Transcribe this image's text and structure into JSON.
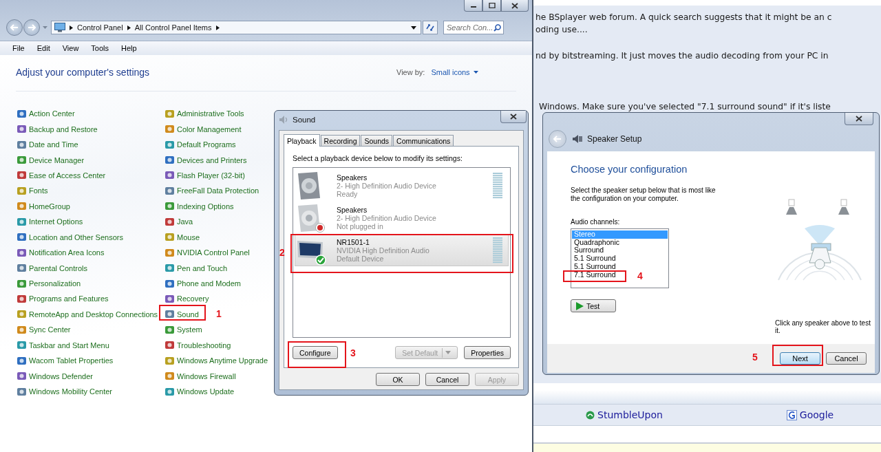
{
  "control_panel": {
    "address": [
      "Control Panel",
      "All Control Panel Items"
    ],
    "search": {
      "placeholder": "Search Con..."
    },
    "menu": [
      "File",
      "Edit",
      "View",
      "Tools",
      "Help"
    ],
    "heading": "Adjust your computer's settings",
    "view_by": {
      "label": "View by:",
      "value": "Small icons"
    },
    "columns": [
      [
        "Action Center",
        "Backup and Restore",
        "Date and Time",
        "Device Manager",
        "Ease of Access Center",
        "Fonts",
        "HomeGroup",
        "Internet Options",
        "Location and Other Sensors",
        "Notification Area Icons",
        "Parental Controls",
        "Personalization",
        "Programs and Features",
        "RemoteApp and Desktop Connections",
        "Sync Center",
        "Taskbar and Start Menu",
        "Wacom Tablet Properties",
        "Windows Defender",
        "Windows Mobility Center"
      ],
      [
        "Administrative Tools",
        "Color Management",
        "Default Programs",
        "Devices and Printers",
        "Flash Player (32-bit)",
        "FreeFall Data Protection",
        "Indexing Options",
        "Java",
        "Mouse",
        "NVIDIA Control Panel",
        "Pen and Touch",
        "Phone and Modem",
        "Recovery",
        "Sound",
        "System",
        "Troubleshooting",
        "Windows Anytime Upgrade",
        "Windows Firewall",
        "Windows Update"
      ]
    ]
  },
  "sound": {
    "title": "Sound",
    "tabs": [
      {
        "label": "Playback",
        "selected": true
      },
      {
        "label": "Recording",
        "selected": false
      },
      {
        "label": "Sounds",
        "selected": false
      },
      {
        "label": "Communications",
        "selected": false
      }
    ],
    "instruction": "Select a playback device below to modify its settings:",
    "devices": [
      {
        "name": "Speakers",
        "description": "2- High Definition Audio Device",
        "status": "Ready",
        "kind": "speaker",
        "unplugged": false,
        "default": false,
        "meter": true,
        "selected": false
      },
      {
        "name": "Speakers",
        "description": "2- High Definition Audio Device",
        "status": "Not plugged in",
        "kind": "speaker",
        "unplugged": true,
        "default": false,
        "meter": false,
        "selected": false
      },
      {
        "name": "NR1501-1",
        "description": "NVIDIA High Definition Audio",
        "status": "Default Device",
        "kind": "monitor",
        "unplugged": false,
        "default": true,
        "meter": true,
        "selected": true
      }
    ],
    "panel_buttons": [
      {
        "label": "Configure",
        "disabled": false,
        "kind": "plain"
      },
      {
        "label": "Set Default",
        "disabled": true,
        "kind": "split"
      },
      {
        "label": "Properties",
        "disabled": false,
        "kind": "plain"
      }
    ],
    "dialog_buttons": [
      {
        "label": "OK",
        "disabled": false
      },
      {
        "label": "Cancel",
        "disabled": false
      },
      {
        "label": "Apply",
        "disabled": true
      }
    ]
  },
  "speaker_setup": {
    "title": "Speaker Setup",
    "heading": "Choose your configuration",
    "description": "Select the speaker setup below that is most like the configuration on your computer.",
    "channels_label": "Audio channels:",
    "channels": [
      {
        "label": "Stereo",
        "selected": true
      },
      {
        "label": "Quadraphonic",
        "selected": false
      },
      {
        "label": "Surround",
        "selected": false
      },
      {
        "label": "5.1 Surround",
        "selected": false
      },
      {
        "label": "5.1 Surround",
        "selected": false
      },
      {
        "label": "7.1 Surround",
        "selected": false
      }
    ],
    "test_button": "Test",
    "hint": "Click any speaker above to test it.",
    "buttons": [
      {
        "label": "Next",
        "default": true
      },
      {
        "label": "Cancel",
        "default": false
      }
    ]
  },
  "web_page": {
    "lines": [
      "he BSplayer web forum. A quick search suggests that it might be an c",
      "oding use....",
      "nd by bitstreaming. It just moves the audio decoding from your PC in",
      "Windows. Make sure you've selected \"7.1 surround sound\" if it's liste"
    ],
    "links": [
      {
        "label": "StumbleUpon",
        "kind": "stumbleupon"
      },
      {
        "label": "Google",
        "kind": "google"
      }
    ]
  },
  "annotations": [
    {
      "label": "1"
    },
    {
      "label": "2"
    },
    {
      "label": "3"
    },
    {
      "label": "4"
    },
    {
      "label": "5"
    }
  ]
}
